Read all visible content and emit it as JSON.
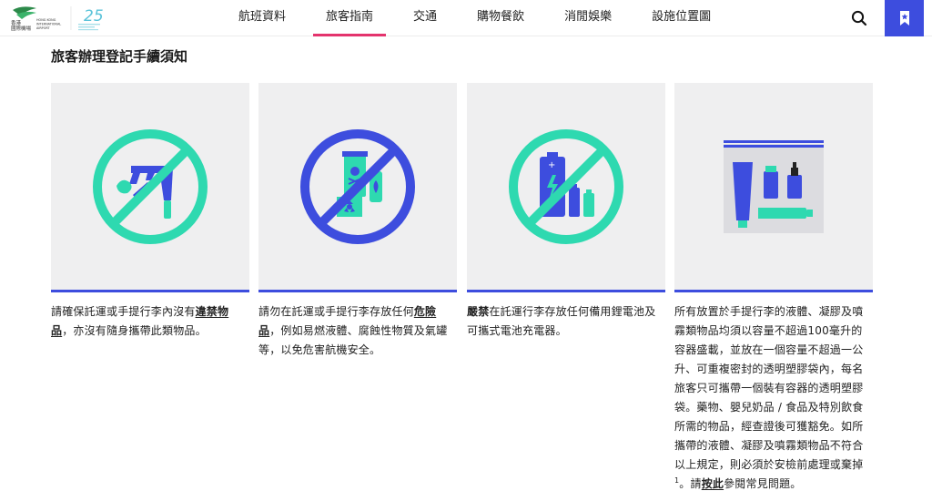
{
  "header": {
    "logo_cn_line1": "香港",
    "logo_cn_line2": "國際機場",
    "logo_en_line1": "HONG KONG",
    "logo_en_line2": "INTERNATIONAL",
    "logo_en_line3": "AIRPORT",
    "anniversary": "25",
    "nav": [
      {
        "label": "航班資料",
        "active": false
      },
      {
        "label": "旅客指南",
        "active": true
      },
      {
        "label": "交通",
        "active": false
      },
      {
        "label": "購物餐飲",
        "active": false
      },
      {
        "label": "消閒娛樂",
        "active": false
      },
      {
        "label": "設施位置圖",
        "active": false
      }
    ],
    "search_icon": "search-icon",
    "bookmark_icon": "bookmark-icon"
  },
  "page": {
    "title": "旅客辦理登記手續須知"
  },
  "cards": [
    {
      "icon": "no-weapons-icon",
      "text_1": "請確保託運或手提行李內沒有",
      "link_1": "違禁物品",
      "text_2": "，亦沒有隨身攜帶此類物品。"
    },
    {
      "icon": "no-dangerous-goods-icon",
      "text_1": "請勿在託運或手提行李存放任何",
      "link_1": "危險品",
      "text_2": "，例如易燃液體、腐蝕性物質及氣罐等，以免危害航機安全。"
    },
    {
      "icon": "no-batteries-icon",
      "strong_1": "嚴禁",
      "text_1": "在託運行李存放任何備用鋰電池及可攜式電池充電器。"
    },
    {
      "icon": "liquids-bag-icon",
      "text_1": "所有放置於手提行李的液體、凝膠及噴霧類物品均須以容量不超過100毫升的容器盛載，並放在一個容量不超過一公升、可重複密封的透明塑膠袋內，每名旅客只可攜帶一個裝有容器的透明塑膠袋。藥物、嬰兒奶品 / 食品及特別飲食所需的物品，經查證後可獲豁免。如所攜帶的液體、凝膠及噴霧類物品不符合以上規定，則必須於安檢前處理或棄掉",
      "sup": "1",
      "text_2": "。請",
      "link_1": "按此",
      "text_3": "參閱常見問題。"
    }
  ],
  "colors": {
    "accent_blue": "#3d4dde",
    "accent_green": "#2ed9b0",
    "nav_active": "#e4336d",
    "card_bg": "#efeff0"
  }
}
